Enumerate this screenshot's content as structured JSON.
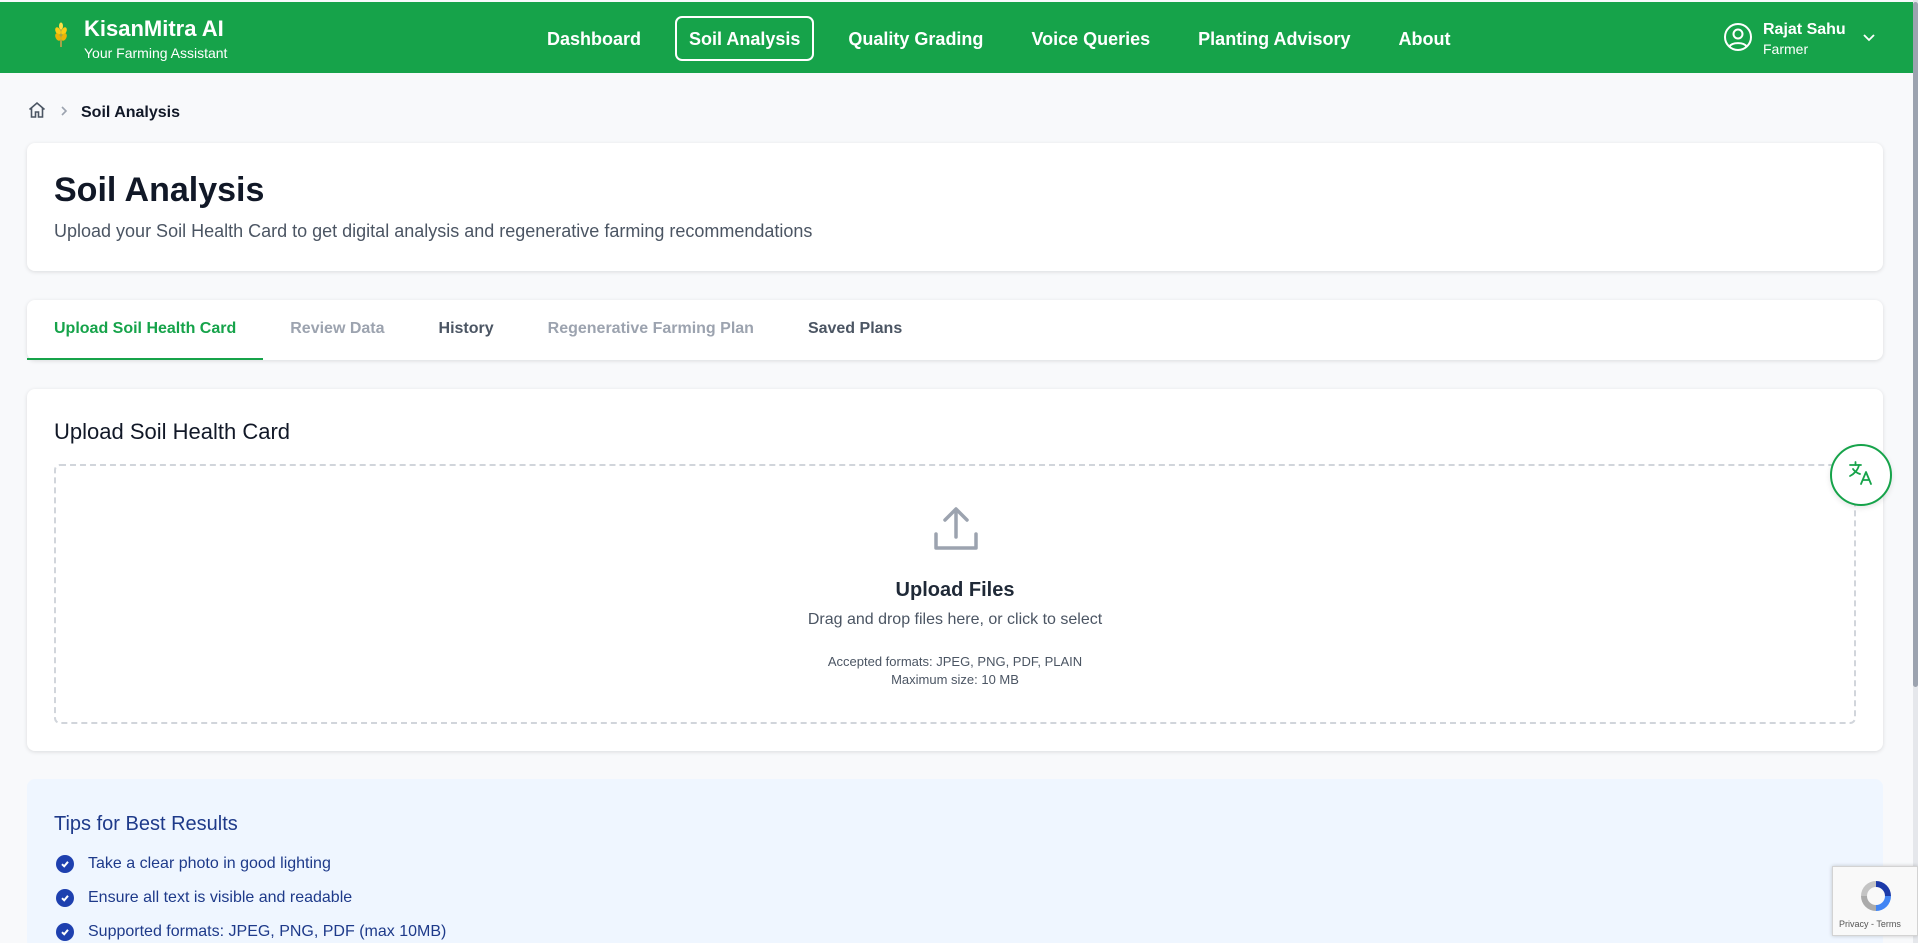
{
  "app": {
    "name": "KisanMitra AI",
    "tagline": "Your Farming Assistant"
  },
  "nav": {
    "items": [
      {
        "label": "Dashboard"
      },
      {
        "label": "Soil Analysis"
      },
      {
        "label": "Quality Grading"
      },
      {
        "label": "Voice Queries"
      },
      {
        "label": "Planting Advisory"
      },
      {
        "label": "About"
      }
    ],
    "active": "Soil Analysis"
  },
  "user": {
    "name": "Rajat Sahu",
    "role": "Farmer"
  },
  "breadcrumb": {
    "current": "Soil Analysis"
  },
  "page": {
    "title": "Soil Analysis",
    "subtitle": "Upload your Soil Health Card to get digital analysis and regenerative farming recommendations"
  },
  "tabs": [
    {
      "label": "Upload Soil Health Card",
      "state": "active"
    },
    {
      "label": "Review Data",
      "state": "disabled"
    },
    {
      "label": "History",
      "state": "enabled"
    },
    {
      "label": "Regenerative Farming Plan",
      "state": "disabled"
    },
    {
      "label": "Saved Plans",
      "state": "enabled"
    }
  ],
  "upload": {
    "heading": "Upload Soil Health Card",
    "title": "Upload Files",
    "instructions": "Drag and drop files here, or click to select",
    "formats": "Accepted formats: JPEG, PNG, PDF, PLAIN",
    "max_size": "Maximum size: 10 MB"
  },
  "tips": {
    "heading": "Tips for Best Results",
    "items": [
      "Take a clear photo in good lighting",
      "Ensure all text is visible and readable",
      "Supported formats: JPEG, PNG, PDF (max 10MB)"
    ]
  },
  "recaptcha": {
    "text": "Privacy - Terms"
  },
  "colors": {
    "primary": "#16a34a",
    "tips_bg": "#eff6ff",
    "tips_text": "#1e3a8a"
  },
  "icons": [
    "wheat-logo-icon",
    "user-circle-icon",
    "chevron-down-icon",
    "home-icon",
    "chevron-right-icon",
    "upload-icon",
    "check-circle-icon",
    "translate-icon",
    "recaptcha-icon"
  ]
}
